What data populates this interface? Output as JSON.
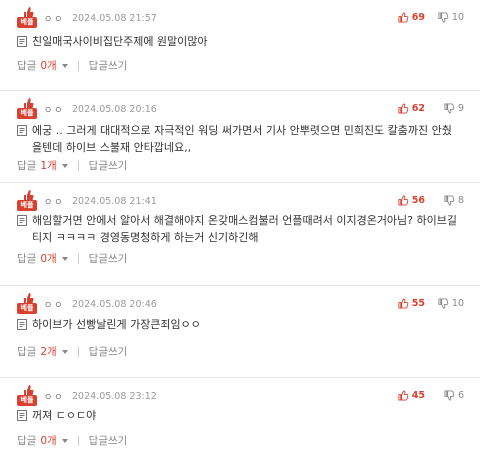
{
  "badge_label": "베플",
  "reply_prefix": "답글",
  "reply_write_label": "답글쓰기",
  "colors": {
    "accent": "#d8412f",
    "muted": "#888888"
  },
  "comments": [
    {
      "nick": "ㅇㅇ",
      "date": "2024.05.08 21:57",
      "likes": "69",
      "dislikes": "10",
      "text": "친일매국사이비집단주제에 원말이많아",
      "reply_count": "0개"
    },
    {
      "nick": "ㅇㅇ",
      "date": "2024.05.08 20:16",
      "likes": "62",
      "dislikes": "9",
      "text": "에궁 .. 그러게 대대적으로 자극적인 워딩 써가면서 기사 안뿌렷으면 민희진도 칼춤까진 안췄을텐데 하이브 스불재 안타깝네요,,",
      "reply_count": "1개"
    },
    {
      "nick": "ㅇㅇ",
      "date": "2024.05.08 21:41",
      "likes": "56",
      "dislikes": "8",
      "text": "해임할거면 안에서 알아서 해결해야지 온갖매스컴불러 언플때려서 이지경온거아님? 하이브길티지 ㅋㅋㅋㅋ 경영동명청하게 하는거 신기하긴해",
      "reply_count": "0개"
    },
    {
      "nick": "ㅇㅇ",
      "date": "2024.05.08 20:46",
      "likes": "55",
      "dislikes": "10",
      "text": "하이브가 선빵날린게 가장큰죄임ㅇㅇ",
      "reply_count": "2개"
    },
    {
      "nick": "ㅇㅇ",
      "date": "2024.05.08 23:12",
      "likes": "45",
      "dislikes": "6",
      "text": "꺼져 ㄷㅇㄷ야",
      "reply_count": "0개"
    }
  ]
}
